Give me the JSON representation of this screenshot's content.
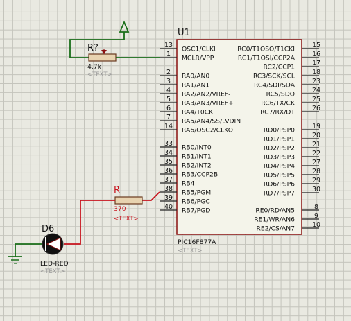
{
  "mcu": {
    "ref": "U1",
    "part": "PIC16F877A",
    "text_placeholder": "<TEXT>",
    "left_pins": [
      {
        "num": "13",
        "name": "OSC1/CLKI"
      },
      {
        "num": "1",
        "name": "MCLR/VPP"
      },
      {
        "num": "2",
        "name": "RA0/AN0"
      },
      {
        "num": "3",
        "name": "RA1/AN1"
      },
      {
        "num": "4",
        "name": "RA2/AN2/VREF-"
      },
      {
        "num": "5",
        "name": "RA3/AN3/VREF+"
      },
      {
        "num": "6",
        "name": "RA4/T0CKI"
      },
      {
        "num": "7",
        "name": "RA5/AN4/SS/LVDIN"
      },
      {
        "num": "14",
        "name": "RA6/OSC2/CLKO"
      },
      {
        "num": "33",
        "name": "RB0/INT0"
      },
      {
        "num": "34",
        "name": "RB1/INT1"
      },
      {
        "num": "35",
        "name": "RB2/INT2"
      },
      {
        "num": "36",
        "name": "RB3/CCP2B"
      },
      {
        "num": "37",
        "name": "RB4"
      },
      {
        "num": "38",
        "name": "RB5/PGM"
      },
      {
        "num": "39",
        "name": "RB6/PGC"
      },
      {
        "num": "40",
        "name": "RB7/PGD"
      }
    ],
    "right_pins": [
      {
        "num": "15",
        "name": "RC0/T1OSO/T1CKI"
      },
      {
        "num": "16",
        "name": "RC1/T1OSI/CCP2A"
      },
      {
        "num": "17",
        "name": "RC2/CCP1"
      },
      {
        "num": "18",
        "name": "RC3/SCK/SCL"
      },
      {
        "num": "23",
        "name": "RC4/SDI/SDA"
      },
      {
        "num": "24",
        "name": "RC5/SDO"
      },
      {
        "num": "25",
        "name": "RC6/TX/CK"
      },
      {
        "num": "26",
        "name": "RC7/RX/DT"
      },
      {
        "num": "19",
        "name": "RD0/PSP0"
      },
      {
        "num": "20",
        "name": "RD1/PSP1"
      },
      {
        "num": "21",
        "name": "RD2/PSP2"
      },
      {
        "num": "22",
        "name": "RD3/PSP3"
      },
      {
        "num": "27",
        "name": "RD4/PSP4"
      },
      {
        "num": "28",
        "name": "RD5/PSP5"
      },
      {
        "num": "29",
        "name": "RD6/PSP6"
      },
      {
        "num": "30",
        "name": "RD7/PSP7"
      },
      {
        "num": "8",
        "name": "RE0/RD/AN5"
      },
      {
        "num": "9",
        "name": "RE1/WR/AN6"
      },
      {
        "num": "10",
        "name": "RE2/CS/AN7"
      }
    ]
  },
  "pot": {
    "ref": "R?",
    "value": "4.7k",
    "text_placeholder": "<TEXT>"
  },
  "resistor": {
    "ref": "R",
    "value": "370",
    "text_placeholder": "<TEXT>"
  },
  "led": {
    "ref": "D6",
    "part": "LED-RED",
    "text_placeholder": "<TEXT>"
  },
  "colors": {
    "background": "#e9e9e1",
    "grid": "#c4c4bc",
    "chip_fill": "#f4f4ea",
    "chip_border": "#8a1010",
    "wire_green": "#1a6e1a",
    "wire_red": "#c8141e",
    "resistor_fill": "#e8d3b0"
  }
}
